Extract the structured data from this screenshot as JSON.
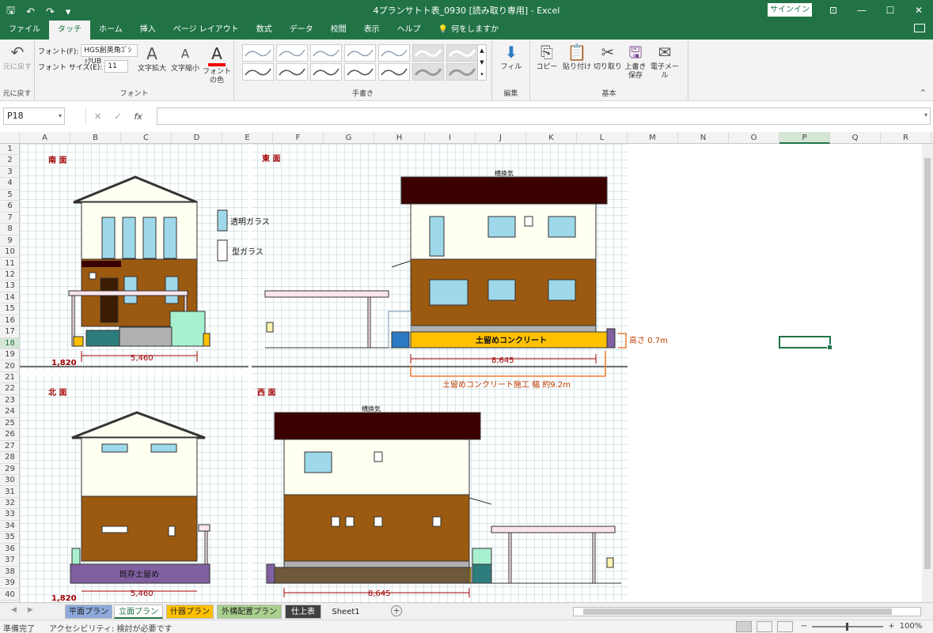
{
  "titlebar": {
    "title": "4プランサトト表_0930 [読み取り専用] - Excel",
    "signin": "サインイン",
    "save_icon": "save-icon",
    "undo_icon": "undo-icon",
    "redo_icon": "redo-icon"
  },
  "tabs": [
    {
      "label": "ファイル"
    },
    {
      "label": "タッチ"
    },
    {
      "label": "ホーム"
    },
    {
      "label": "挿入"
    },
    {
      "label": "ページ レイアウト"
    },
    {
      "label": "数式"
    },
    {
      "label": "データ"
    },
    {
      "label": "校閲"
    },
    {
      "label": "表示"
    },
    {
      "label": "ヘルプ"
    }
  ],
  "tell_me": "何をしますか",
  "ribbon": {
    "undo_label": "元に戻す",
    "undo_group": "元に戻す",
    "font_label": "フォント(F):",
    "font_value": "HGS創英角ｺﾞｼｯｸUB",
    "size_label": "フォント サイズ(E):",
    "size_value": "11",
    "grow_label": "文字拡大",
    "shrink_label": "文字縮小",
    "font_color_label": "フォントの色",
    "font_group": "フォント",
    "pens_group": "手書き",
    "fill_label": "フィル",
    "edit_group": "編集",
    "copy_label": "コピー",
    "paste_label": "貼り付け",
    "cut_label": "切り取り",
    "save_label": "上書き保存",
    "mail_label": "電子メール",
    "basic_group": "基本"
  },
  "formula_bar": {
    "name_box": "P18",
    "cancel_icon": "✕",
    "enter_icon": "✓",
    "fx": "fx",
    "formula": ""
  },
  "columns": [
    "A",
    "B",
    "C",
    "D",
    "E",
    "F",
    "G",
    "H",
    "I",
    "J",
    "K",
    "L",
    "M",
    "N",
    "O",
    "P",
    "Q",
    "R"
  ],
  "rows": [
    "1",
    "2",
    "3",
    "4",
    "5",
    "6",
    "7",
    "8",
    "9",
    "10",
    "11",
    "12",
    "13",
    "14",
    "15",
    "16",
    "17",
    "18",
    "19",
    "20",
    "21",
    "22",
    "23",
    "24",
    "25",
    "26",
    "27",
    "28",
    "29",
    "30",
    "31",
    "32",
    "33",
    "34",
    "35",
    "36",
    "37",
    "38",
    "39",
    "40"
  ],
  "drawing": {
    "south_title": "南 面",
    "east_title": "東 面",
    "north_title": "北 面",
    "west_title": "西 面",
    "legend_clear": "透明ガラス",
    "legend_frosted": "型ガラス",
    "vent_label_east": "横換気",
    "vent_label_west": "横換気",
    "retaining_wall_label": "土留めコンクリート",
    "height_label": "高さ 0.7m",
    "construction_note": "土留めコンクリート施工 幅 約9.2m",
    "existing_wall_label": "既存土留め",
    "dim_south_left": "1,820",
    "dim_south_width": "5,460",
    "dim_east_width": "8,645",
    "dim_north_left": "1,820",
    "dim_north_width": "5,460",
    "dim_west_width": "8,645"
  },
  "sheet_tabs": [
    {
      "label": "平面プラン",
      "color": "#8ea9db"
    },
    {
      "label": "立面プラン",
      "color": "#ffffff"
    },
    {
      "label": "什器プラン",
      "color": "#ffc000"
    },
    {
      "label": "外構配置プラン",
      "color": "#a9d08e"
    },
    {
      "label": "仕上表",
      "color": "#404040"
    },
    {
      "label": "Sheet1",
      "color": "#f0f0f0"
    }
  ],
  "status": {
    "ready": "準備完了",
    "accessibility": "アクセシビリティ: 検討が必要です",
    "zoom": "100%"
  },
  "colors": {
    "excel_green": "#217346",
    "wall_cream": "#fffff2",
    "wall_brown": "#9b5a10",
    "roof_dark": "#3b0000",
    "glass": "#9fd8ea",
    "concrete": "#ffc000",
    "retaining": "#8060a0"
  }
}
